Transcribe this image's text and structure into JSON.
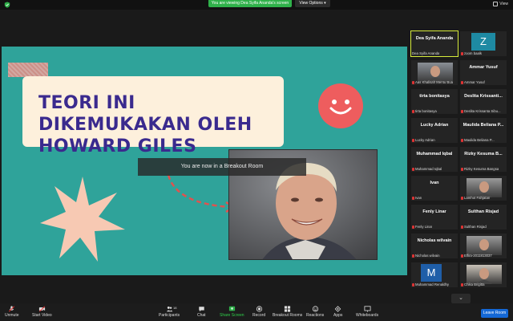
{
  "topbar": {
    "banner": "You are viewing Dea Syifa Ananda's screen",
    "view_options": "View Options ▾",
    "view": "View"
  },
  "slide": {
    "title": "TEORI INI DIKEMUKAKAN OLEH HOWARD GILES",
    "breakout_notice": "You are now in a Breakout Room"
  },
  "participants": [
    {
      "big": "Dea Syifa Ananda",
      "small": "Dea Syifa Ananda",
      "muted": false,
      "active": true
    },
    {
      "big": "Z",
      "small": "zoom baalk",
      "muted": true,
      "kind": "avatar"
    },
    {
      "big": "",
      "small": "Aas Khalisah Mentu Bua",
      "muted": true,
      "kind": "photo"
    },
    {
      "big": "Ammar Yusuf",
      "small": "Ammar Yusuf",
      "muted": true
    },
    {
      "big": "tirta bonitasya",
      "small": "tirta bonitasya",
      "muted": true
    },
    {
      "big": "Deslita Krissanti...",
      "small": "Deslita Krissanta Sibu...",
      "muted": true
    },
    {
      "big": "Lucky Adrian",
      "small": "Lucky Adrian",
      "muted": true
    },
    {
      "big": "Maulida Beliana P...",
      "small": "Maulida Beliana P...",
      "muted": true
    },
    {
      "big": "Muhammad Iqbal",
      "small": "Muhammad Iqbal",
      "muted": true
    },
    {
      "big": "Rizky Kesuma B...",
      "small": "Rizky Kesuma Bangsa",
      "muted": true
    },
    {
      "big": "Ivan",
      "small": "Ivan",
      "muted": true
    },
    {
      "big": "",
      "small": "Lamhot Fahjatan",
      "muted": true,
      "kind": "photo"
    },
    {
      "big": "Fenly Linar",
      "small": "Fenly Linar",
      "muted": true
    },
    {
      "big": "Sulthan Risjad",
      "small": "Sulthan Risjad",
      "muted": true
    },
    {
      "big": "Nicholas wilvain",
      "small": "Nicholas wilvain",
      "muted": true
    },
    {
      "big": "",
      "small": "Elfira-2011813037",
      "muted": true,
      "kind": "photo"
    },
    {
      "big": "M",
      "small": "Muhammad Renaldhy",
      "muted": true,
      "kind": "avatarM"
    },
    {
      "big": "",
      "small": "Chika Brigitta",
      "muted": true,
      "kind": "photo"
    }
  ],
  "toolbar": {
    "unmute": "Unmute",
    "start_video": "Start Video",
    "participants": "Participants",
    "participants_count": "18",
    "chat": "Chat",
    "share_screen": "Share Screen",
    "record": "Record",
    "breakout_rooms": "Breakout Rooms",
    "reactions": "Reactions",
    "apps": "Apps",
    "whiteboards": "Whiteboards",
    "leave_room": "Leave Room"
  },
  "colors": {
    "slide_bg": "#2fa39a",
    "title_color": "#3a2a8e",
    "card": "#fdf0dc",
    "smile": "#ee5d5e",
    "accent_green": "#2fb14a",
    "leave_blue": "#1468d6",
    "active_border": "#d7ec3b"
  }
}
